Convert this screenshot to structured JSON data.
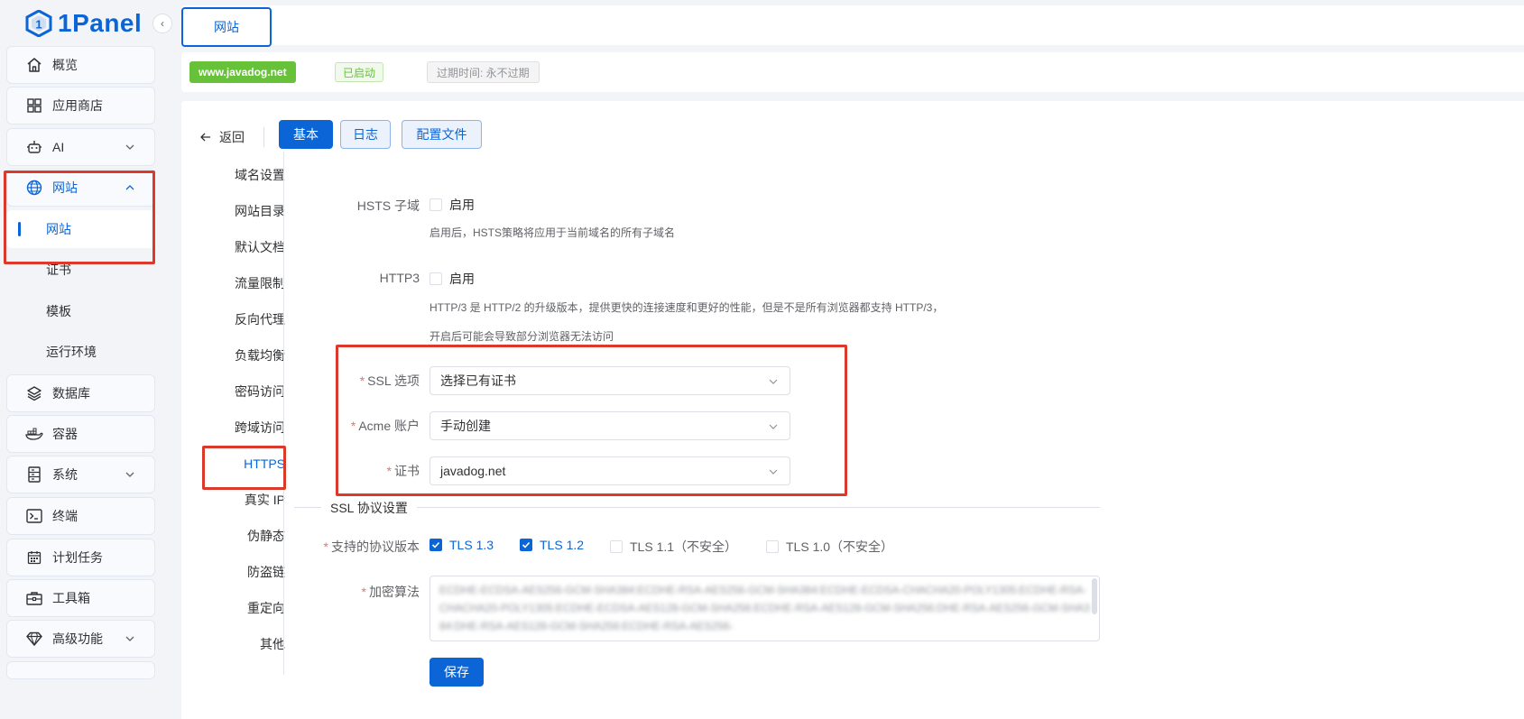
{
  "brand": {
    "name": "1Panel",
    "accent": "#0c65d6",
    "highlight_box": "#d93a2b"
  },
  "sidebar": {
    "collapse_icon": "chevron-left-icon",
    "items": [
      {
        "label": "概览",
        "icon": "home-icon"
      },
      {
        "label": "应用商店",
        "icon": "grid-icon"
      },
      {
        "label": "AI",
        "icon": "robot-icon",
        "chevron": "chevron-down-icon"
      },
      {
        "label": "网站",
        "icon": "globe-icon",
        "chevron": "chevron-up-icon",
        "expanded": true
      },
      {
        "label": "数据库",
        "icon": "layers-icon"
      },
      {
        "label": "容器",
        "icon": "docker-icon"
      },
      {
        "label": "系统",
        "icon": "server-icon",
        "chevron": "chevron-down-icon"
      },
      {
        "label": "终端",
        "icon": "terminal-icon"
      },
      {
        "label": "计划任务",
        "icon": "calendar-icon"
      },
      {
        "label": "工具箱",
        "icon": "toolbox-icon"
      },
      {
        "label": "高级功能",
        "icon": "diamond-icon",
        "chevron": "chevron-down-icon"
      }
    ],
    "website_children": [
      "网站",
      "证书",
      "模板",
      "运行环境"
    ]
  },
  "tabs": [
    {
      "label": "网站"
    }
  ],
  "site_info": {
    "domain": "www.javadog.net",
    "status": "已启动",
    "expire": "过期时间: 永不过期"
  },
  "toolbar": {
    "back_label": "返回",
    "tabs": [
      "基本",
      "日志",
      "配置文件"
    ],
    "active_tab": "基本"
  },
  "subnav": {
    "items": [
      "域名设置",
      "网站目录",
      "默认文档",
      "流量限制",
      "反向代理",
      "负载均衡",
      "密码访问",
      "跨域访问",
      "HTTPS",
      "真实 IP",
      "伪静态",
      "防盗链",
      "重定向",
      "其他"
    ],
    "active": "HTTPS"
  },
  "form": {
    "hsts_subdomain": {
      "label": "HSTS 子域",
      "checkbox_label": "启用",
      "checked": false,
      "help": "启用后，HSTS策略将应用于当前域名的所有子域名"
    },
    "http3": {
      "label": "HTTP3",
      "checkbox_label": "启用",
      "checked": false,
      "help_line1": "HTTP/3 是 HTTP/2 的升级版本，提供更快的连接速度和更好的性能，但是不是所有浏览器都支持 HTTP/3，",
      "help_line2": "开启后可能会导致部分浏览器无法访问"
    },
    "ssl_option": {
      "label": "SSL 选项",
      "required": "*",
      "value": "选择已有证书"
    },
    "acme_account": {
      "label": "Acme 账户",
      "required": "*",
      "value": "手动创建"
    },
    "certificate": {
      "label": "证书",
      "required": "*",
      "value": "javadog.net"
    },
    "ssl_protocol_divider": "SSL 协议设置",
    "protocols": {
      "label": "支持的协议版本",
      "required": "*",
      "options": [
        {
          "label": "TLS 1.3",
          "checked": true
        },
        {
          "label": "TLS 1.2",
          "checked": true
        },
        {
          "label": "TLS 1.1（不安全）",
          "checked": false
        },
        {
          "label": "TLS 1.0（不安全）",
          "checked": false
        }
      ]
    },
    "ciphers": {
      "label": "加密算法",
      "required": "*",
      "value": "ECDHE-ECDSA-AES256-GCM-SHA384:ECDHE-RSA-AES256-GCM-SHA384:ECDHE-ECDSA-CHACHA20-POLY1305:ECDHE-RSA-CHACHA20-POLY1305:ECDHE-ECDSA-AES128-GCM-SHA256:ECDHE-RSA-AES128-GCM-SHA256:DHE-RSA-AES256-GCM-SHA384:DHE-RSA-AES128-GCM-SHA256:ECDHE-RSA-AES256-"
    },
    "save_label": "保存"
  }
}
